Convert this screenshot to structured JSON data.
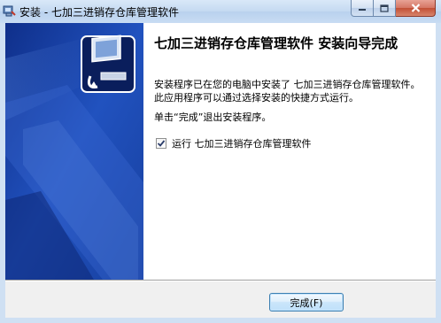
{
  "window": {
    "title": "安装 - 七加三进销存仓库管理软件",
    "icon": "installer-icon",
    "controls": [
      "minimize-icon",
      "maximize-icon",
      "close-icon"
    ]
  },
  "banner": {
    "icon": "installer-computer-icon",
    "colors": {
      "primary": "#1a3d99",
      "accent": "#4a7ad8"
    }
  },
  "content": {
    "heading": "七加三进销存仓库管理软件 安装向导完成",
    "description": "安装程序已在您的电脑中安装了 七加三进销存仓库管理软件。此应用程序可以通过选择安装的快捷方式运行。",
    "hint": "单击“完成”退出安装程序。",
    "run_option": {
      "label": "运行 七加三进销存仓库管理软件",
      "checked": true
    }
  },
  "buttons": {
    "finish_label": "完成(F)"
  }
}
